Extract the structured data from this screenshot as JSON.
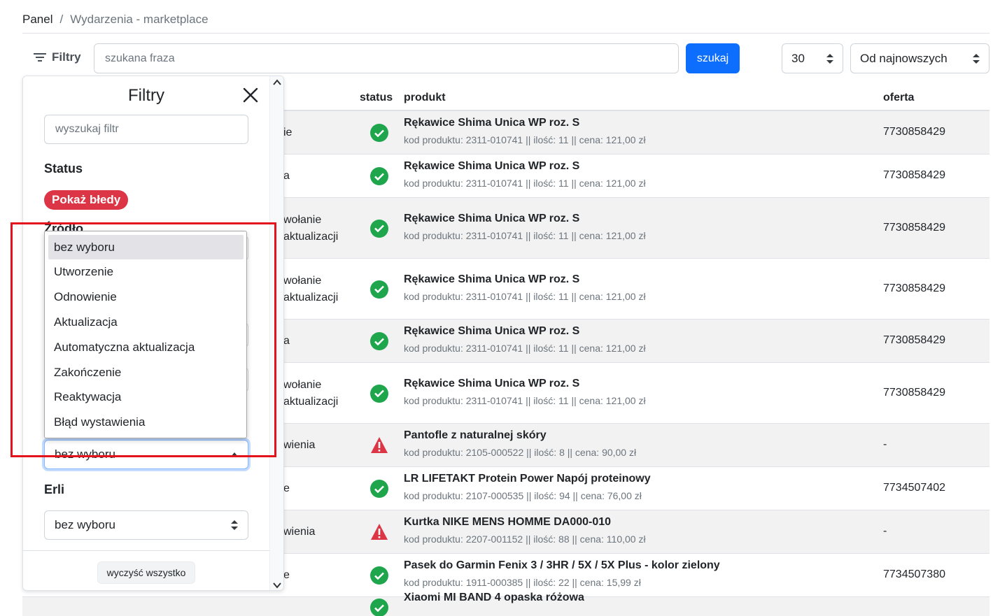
{
  "breadcrumb": {
    "home": "Panel",
    "separator": "/",
    "current": "Wydarzenia - marketplace"
  },
  "toolbar": {
    "filters_label": "Filtry",
    "search_placeholder": "szukana fraza",
    "search_button": "szukaj",
    "per_page": "30",
    "sort": "Od najnowszych"
  },
  "table": {
    "headers": {
      "status": "status",
      "product": "produkt",
      "offer": "oferta"
    },
    "rows": [
      {
        "tail1": "ie",
        "tail2": "",
        "status": "ok",
        "name": "Rękawice Shima Unica WP roz. S",
        "meta": "kod produktu: 2311-010741 || ilość: 11 || cena: 121,00 zł",
        "offer": "7730858429"
      },
      {
        "tail1": "a",
        "tail2": "",
        "status": "ok",
        "name": "Rękawice Shima Unica WP roz. S",
        "meta": "kod produktu: 2311-010741 || ilość: 11 || cena: 121,00 zł",
        "offer": "7730858429"
      },
      {
        "tail1": "wołanie",
        "tail2": "aktualizacji",
        "status": "ok",
        "name": "Rękawice Shima Unica WP roz. S",
        "meta": "kod produktu: 2311-010741 || ilość: 11 || cena: 121,00 zł",
        "offer": "7730858429"
      },
      {
        "tail1": "wołanie",
        "tail2": "aktualizacji",
        "status": "ok",
        "name": "Rękawice Shima Unica WP roz. S",
        "meta": "kod produktu: 2311-010741 || ilość: 11 || cena: 121,00 zł",
        "offer": "7730858429"
      },
      {
        "tail1": "a",
        "tail2": "",
        "status": "ok",
        "name": "Rękawice Shima Unica WP roz. S",
        "meta": "kod produktu: 2311-010741 || ilość: 11 || cena: 121,00 zł",
        "offer": "7730858429"
      },
      {
        "tail1": "wołanie",
        "tail2": "aktualizacji",
        "status": "ok",
        "name": "Rękawice Shima Unica WP roz. S",
        "meta": "kod produktu: 2311-010741 || ilość: 11 || cena: 121,00 zł",
        "offer": "7730858429"
      },
      {
        "tail1": "wienia",
        "tail2": "",
        "status": "error",
        "name": "Pantofle z naturalnej skóry",
        "meta": "kod produktu: 2105-000522 || ilość: 8 || cena: 90,00 zł",
        "offer": "-"
      },
      {
        "tail1": "e",
        "tail2": "",
        "status": "ok",
        "name": "LR LIFETAKT Protein Power Napój proteinowy",
        "meta": "kod produktu: 2107-000535 || ilość: 94 || cena: 76,00 zł",
        "offer": "7734507402"
      },
      {
        "tail1": "wienia",
        "tail2": "",
        "status": "error",
        "name": "Kurtka NIKE MENS HOMME DA000-010",
        "meta": "kod produktu: 2207-001152 || ilość: 88 || cena: 110,00 zł",
        "offer": "-"
      },
      {
        "tail1": "e",
        "tail2": "",
        "status": "ok",
        "name": "Pasek do Garmin Fenix 3 / 3HR / 5X / 5X Plus - kolor zielony",
        "meta": "kod produktu: 1911-000385 || ilość: 22 || cena: 15,99 zł",
        "offer": "7734507380"
      },
      {
        "tail1": "",
        "tail2": "",
        "status": "ok",
        "name": "Xiaomi MI BAND 4 opaska różowa",
        "meta": "",
        "offer": ""
      }
    ]
  },
  "filters_panel": {
    "title": "Filtry",
    "search_placeholder": "wyszukaj filtr",
    "status_title": "Status",
    "errors_badge": "Pokaż błedy",
    "source_title": "Źródło",
    "source_value": "bez wyboru",
    "erli_title": "Erli",
    "erli_value": "bez wyboru",
    "clear_all": "wyczyść wszystko"
  },
  "dropdown": {
    "options": [
      "bez wyboru",
      "Utworzenie",
      "Odnowienie",
      "Aktualizacja",
      "Automatyczna aktualizacja",
      "Zakończenie",
      "Reaktywacja",
      "Błąd wystawienia"
    ],
    "selected_index": 0
  },
  "colors": {
    "primary": "#0d6efd",
    "success": "#1fa64d",
    "danger": "#dc3545",
    "highlight": "#e3121b"
  }
}
